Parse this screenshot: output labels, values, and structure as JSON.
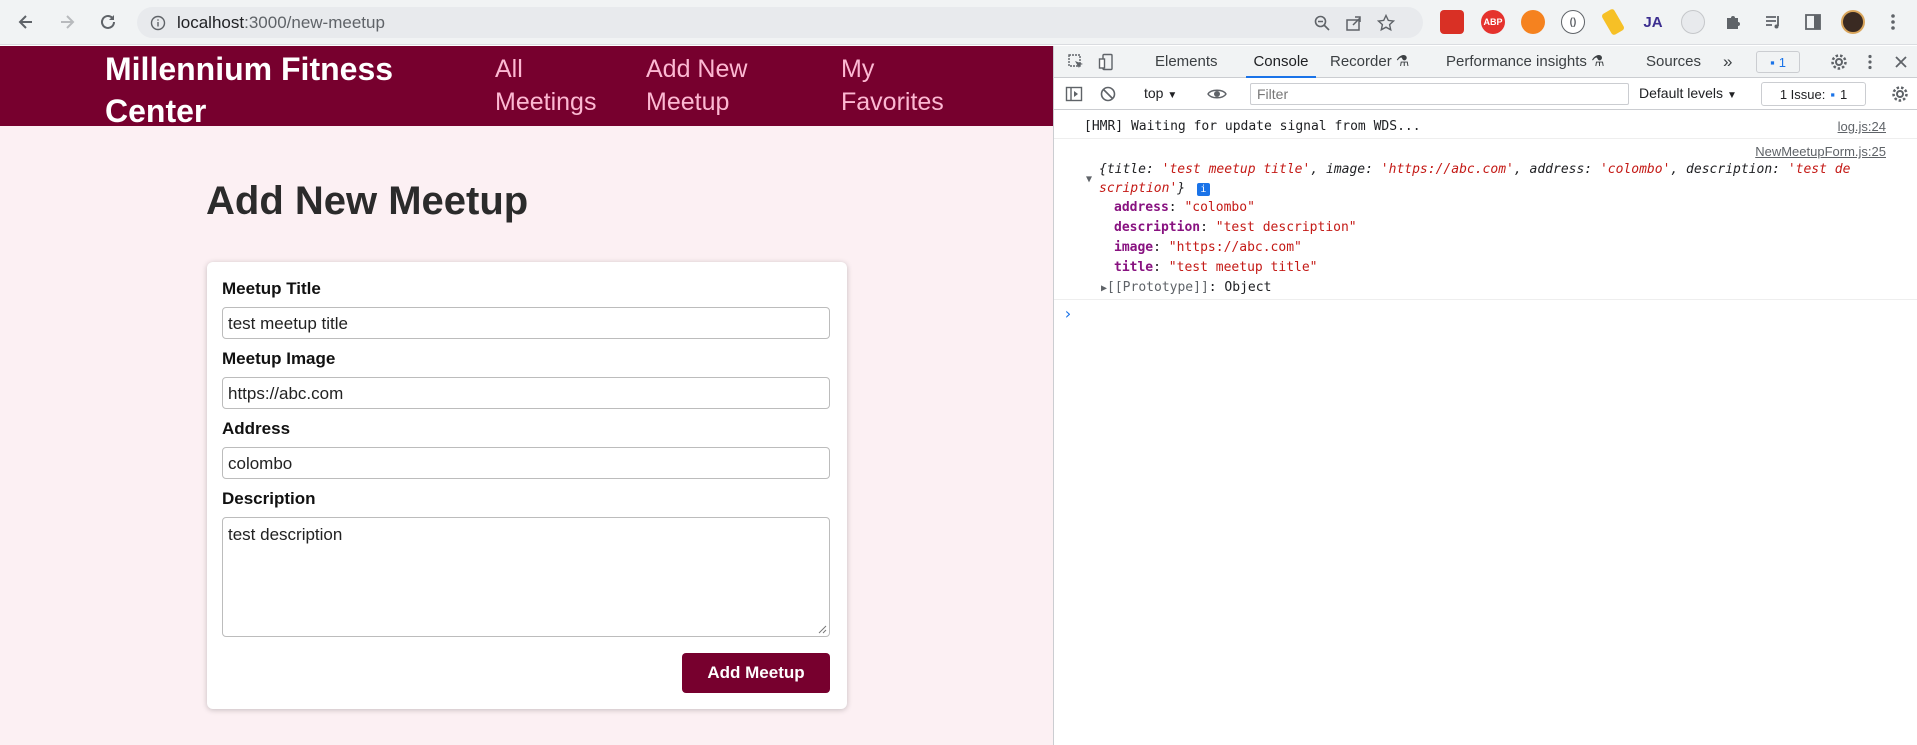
{
  "browser": {
    "url_host": "localhost",
    "url_path": ":3000/new-meetup"
  },
  "app": {
    "brand": "Millennium Fitness Center",
    "nav": [
      {
        "line1": "All",
        "line2": "Meetings"
      },
      {
        "line1": "Add New",
        "line2": "Meetup"
      },
      {
        "line1": "My",
        "line2": "Favorites"
      }
    ],
    "page_title": "Add New Meetup",
    "form": {
      "title_label": "Meetup Title",
      "title_value": "test meetup title",
      "image_label": "Meetup Image",
      "image_value": "https://abc.com",
      "address_label": "Address",
      "address_value": "colombo",
      "description_label": "Description",
      "description_value": "test description",
      "submit_label": "Add Meetup"
    },
    "colors": {
      "brand": "#77002e",
      "nav_text": "#fcb8d2",
      "page_bg": "#fcf0f3"
    }
  },
  "devtools": {
    "tabs": [
      "Elements",
      "Console",
      "Recorder",
      "Performance insights",
      "Sources"
    ],
    "active_tab": "Console",
    "message_badge": "1",
    "context": "top",
    "filter_placeholder": "Filter",
    "levels": "Default levels",
    "issues_label": "1 Issue:",
    "issues_count": "1",
    "log1": {
      "text": "[HMR] Waiting for update signal from WDS...",
      "source": "log.js:24"
    },
    "log2": {
      "source": "NewMeetupForm.js:25",
      "summary": {
        "open": "{title: ",
        "title_val": "'test meetup title'",
        "image_key": ", image: ",
        "image_val": "'https://abc.com'",
        "address_key": ", address: ",
        "address_val": "'colombo'",
        "description_key": ", description: ",
        "description_val_1": "'test de",
        "description_val_2": "scription'",
        "close": "}"
      },
      "props": [
        {
          "key": "address",
          "value": "\"colombo\""
        },
        {
          "key": "description",
          "value": "\"test description\""
        },
        {
          "key": "image",
          "value": "\"https://abc.com\""
        },
        {
          "key": "title",
          "value": "\"test meetup title\""
        }
      ],
      "prototype_key": "[[Prototype]]",
      "prototype_value": ": Object"
    },
    "prompt": "›"
  }
}
